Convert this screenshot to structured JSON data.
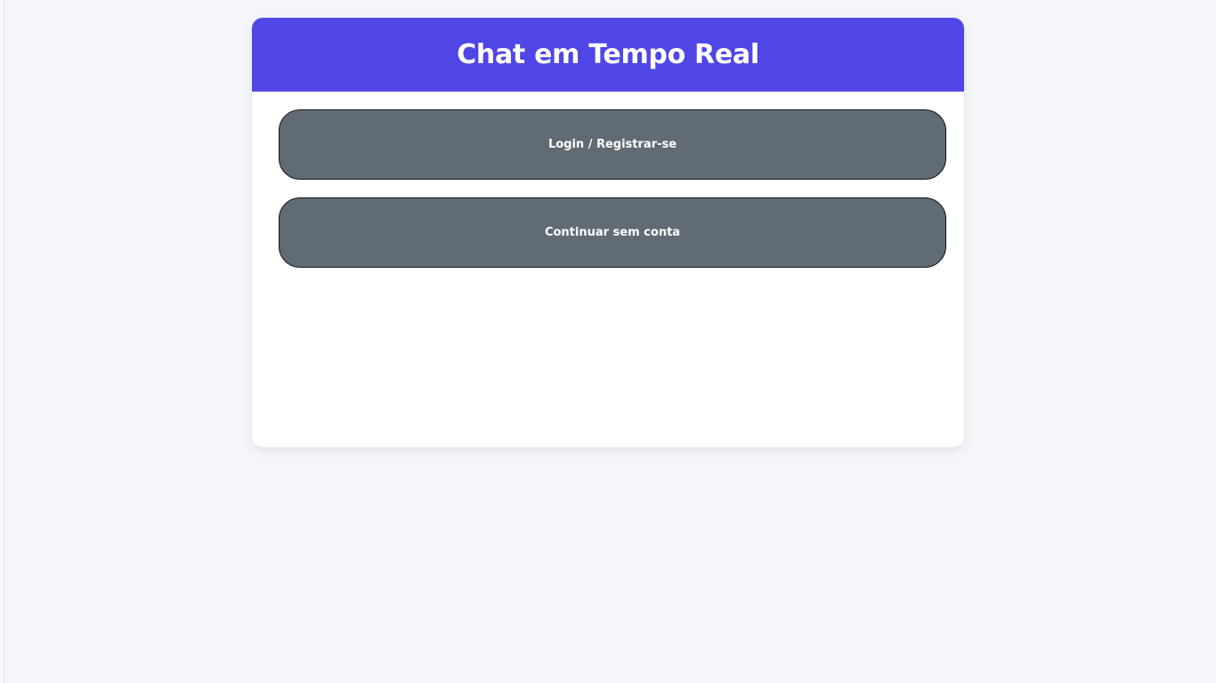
{
  "app": {
    "title": "Chat em Tempo Real"
  },
  "actions": {
    "login_label": "Login / Registrar-se",
    "guest_label": "Continuar sem conta"
  },
  "colors": {
    "page_background": "#f5f6fa",
    "header_accent": "#4f46e5",
    "button_background": "#616b73",
    "button_text": "#ffffff"
  }
}
